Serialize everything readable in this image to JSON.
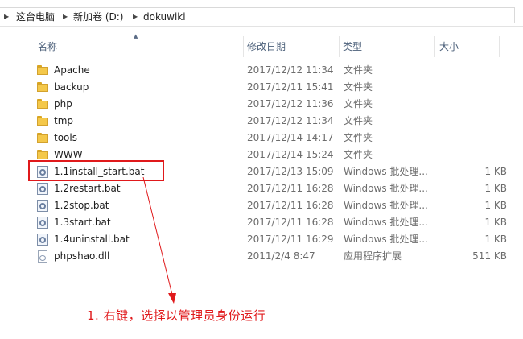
{
  "breadcrumb": [
    "这台电脑",
    "新加卷 (D:)",
    "dokuwiki"
  ],
  "columns": {
    "name": "名称",
    "date": "修改日期",
    "type": "类型",
    "size": "大小"
  },
  "files": [
    {
      "name": "Apache",
      "date": "2017/12/12 11:34",
      "type": "文件夹",
      "size": "",
      "icon": "folder-icon"
    },
    {
      "name": "backup",
      "date": "2017/12/11 15:41",
      "type": "文件夹",
      "size": "",
      "icon": "folder-icon"
    },
    {
      "name": "php",
      "date": "2017/12/12 11:36",
      "type": "文件夹",
      "size": "",
      "icon": "folder-icon"
    },
    {
      "name": "tmp",
      "date": "2017/12/12 11:34",
      "type": "文件夹",
      "size": "",
      "icon": "folder-icon"
    },
    {
      "name": "tools",
      "date": "2017/12/14 14:17",
      "type": "文件夹",
      "size": "",
      "icon": "folder-icon"
    },
    {
      "name": "WWW",
      "date": "2017/12/14 15:24",
      "type": "文件夹",
      "size": "",
      "icon": "folder-icon"
    },
    {
      "name": "1.1install_start.bat",
      "date": "2017/12/13 15:09",
      "type": "Windows 批处理...",
      "size": "1 KB",
      "icon": "batch-file-icon"
    },
    {
      "name": "1.2restart.bat",
      "date": "2017/12/11 16:28",
      "type": "Windows 批处理...",
      "size": "1 KB",
      "icon": "batch-file-icon"
    },
    {
      "name": "1.2stop.bat",
      "date": "2017/12/11 16:28",
      "type": "Windows 批处理...",
      "size": "1 KB",
      "icon": "batch-file-icon"
    },
    {
      "name": "1.3start.bat",
      "date": "2017/12/11 16:28",
      "type": "Windows 批处理...",
      "size": "1 KB",
      "icon": "batch-file-icon"
    },
    {
      "name": "1.4uninstall.bat",
      "date": "2017/12/11 16:29",
      "type": "Windows 批处理...",
      "size": "1 KB",
      "icon": "batch-file-icon"
    },
    {
      "name": "phpshao.dll",
      "date": "2011/2/4 8:47",
      "type": "应用程序扩展",
      "size": "511 KB",
      "icon": "dll-file-icon"
    }
  ],
  "annotation": {
    "text": "1.  右键，选择以管理员身份运行",
    "color": "#e0191b"
  }
}
